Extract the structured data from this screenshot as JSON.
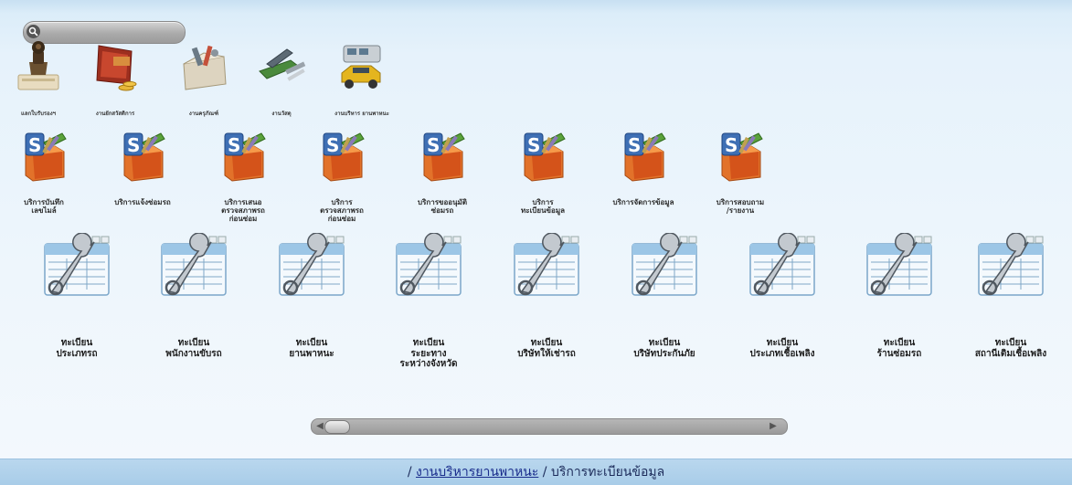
{
  "search": {
    "icon": "search-icon"
  },
  "top_row": [
    {
      "label": "แลกใบรับรองฯ",
      "icon": "certificate-stamp-icon"
    },
    {
      "label": "งานยักสวัสดิการ",
      "icon": "wallet-coins-icon"
    },
    {
      "label": "งานครุภัณฑ์",
      "icon": "tools-crate-icon"
    },
    {
      "label": "งานวัสดุ",
      "icon": "stapler-supplies-icon"
    },
    {
      "label": "งานบริหาร ยานพาหนะ",
      "icon": "vehicles-icon"
    }
  ],
  "service_row": [
    {
      "lines": [
        "บริการบันทึก",
        "เลขไมล์"
      ]
    },
    {
      "lines": [
        "บริการแจ้งซ่อมรถ"
      ]
    },
    {
      "lines": [
        "บริการเสนอ",
        "ตรวจสภาพรถ",
        "ก่อนซ่อม"
      ]
    },
    {
      "lines": [
        "บริการ",
        "ตรวจสภาพรถ",
        "ก่อนซ่อม"
      ]
    },
    {
      "lines": [
        "บริการขออนุมัติ",
        "ซ่อมรถ"
      ]
    },
    {
      "lines": [
        "บริการ",
        "ทะเบียนข้อมูล"
      ]
    },
    {
      "lines": [
        "บริการจัดการข้อมูล"
      ]
    },
    {
      "lines": [
        "บริการสอบถาม",
        "/รายงาน"
      ]
    }
  ],
  "service_icon": "service-box-icon",
  "registry_row": [
    {
      "lines": [
        "ทะเบียน",
        "ประเภทรถ"
      ]
    },
    {
      "lines": [
        "ทะเบียน",
        "พนักงานขับรถ"
      ]
    },
    {
      "lines": [
        "ทะเบียน",
        "ยานพาหนะ"
      ]
    },
    {
      "lines": [
        "ทะเบียน",
        "ระยะทาง",
        "ระหว่างจังหวัด"
      ]
    },
    {
      "lines": [
        "ทะเบียน",
        "บริษัทให้เช่ารถ"
      ]
    },
    {
      "lines": [
        "ทะเบียน",
        "บริษัทประกันภัย"
      ]
    },
    {
      "lines": [
        "ทะเบียน",
        "ประเภทเชื้อเพลิง"
      ]
    },
    {
      "lines": [
        "ทะเบียน",
        "ร้านซ่อมรถ"
      ]
    },
    {
      "lines": [
        "ทะเบียน",
        "สถานีเติมเชื้อเพลิง"
      ]
    }
  ],
  "registry_icon": "wrench-window-icon",
  "scrollbar": {
    "left_arrow": "◀",
    "right_arrow": "▶"
  },
  "breadcrumb": {
    "sep1": "/",
    "link": "งานบริหารยานพาหนะ",
    "sep2": "/",
    "current": "บริการทะเบียนข้อมูล"
  },
  "colors": {
    "background": "#e6f2fb",
    "footer": "#b3d3ec",
    "link": "#1a2d8c"
  }
}
